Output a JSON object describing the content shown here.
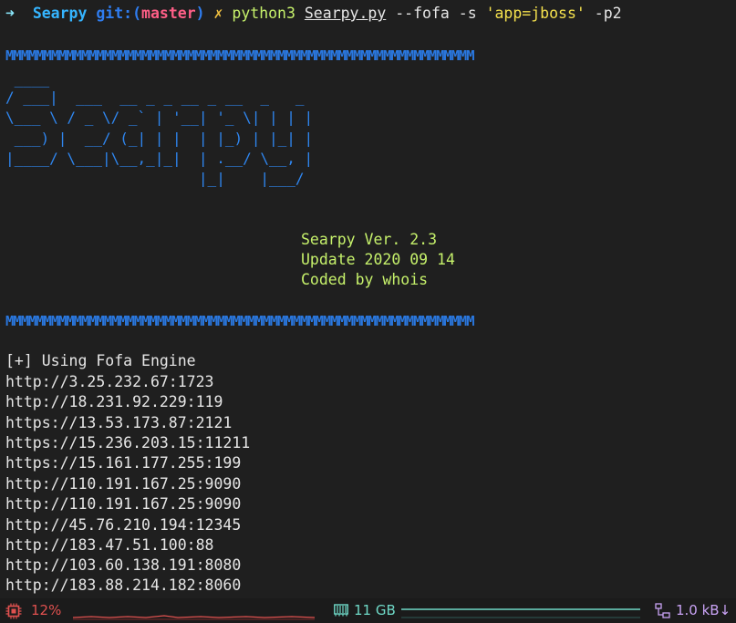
{
  "prompt": {
    "arrow": "➜",
    "directory": "Searpy",
    "git_label": "git:(",
    "branch": "master",
    "git_close": ")",
    "dirty_mark": "✗",
    "command": "python3",
    "file": "Searpy.py",
    "args_before": "--fofa -s",
    "string_arg": "'app=jboss'",
    "args_after": "-p2"
  },
  "separator": "MMMMMMMMMMMMMMMMMMMMMMMMMMMMMMMMMMMMMMMMMMMMMMMMMMMMMMMMMMMMMM",
  "ascii_art": [
    " ____",
    "/ ___|  ___  __ _ _ __ _ __  _   _",
    "\\___ \\ / _ \\/ _` | '__| '_ \\| | | |",
    " ___) |  __/ (_| | |  | |_) | |_| |",
    "|____/ \\___|\\__,_|_|  | .__/ \\__, |",
    "                      |_|    |___/"
  ],
  "banner": {
    "version": "Searpy Ver. 2.3",
    "update": "Update 2020 09 14",
    "author": "Coded by whois"
  },
  "output": {
    "engine_line": "[+] Using Fofa Engine",
    "results": [
      "http://3.25.232.67:1723",
      "http://18.231.92.229:119",
      "https://13.53.173.87:2121",
      "https://15.236.203.15:11211",
      "https://15.161.177.255:199",
      "http://110.191.167.25:9090",
      "http://110.191.167.25:9090",
      "http://45.76.210.194:12345",
      "http://183.47.51.100:88",
      "http://103.60.138.191:8080",
      "http://183.88.214.182:8060"
    ]
  },
  "statusbar": {
    "cpu_icon": "cpu-chip-icon",
    "cpu": "12%",
    "mem_icon": "memory-icon",
    "memory": "11 GB",
    "net_icon": "network-icon",
    "network": "1.0 kB↓",
    "colors": {
      "cpu": "#e0514f",
      "memory": "#6fd9c7",
      "network": "#c9a3f5"
    }
  }
}
